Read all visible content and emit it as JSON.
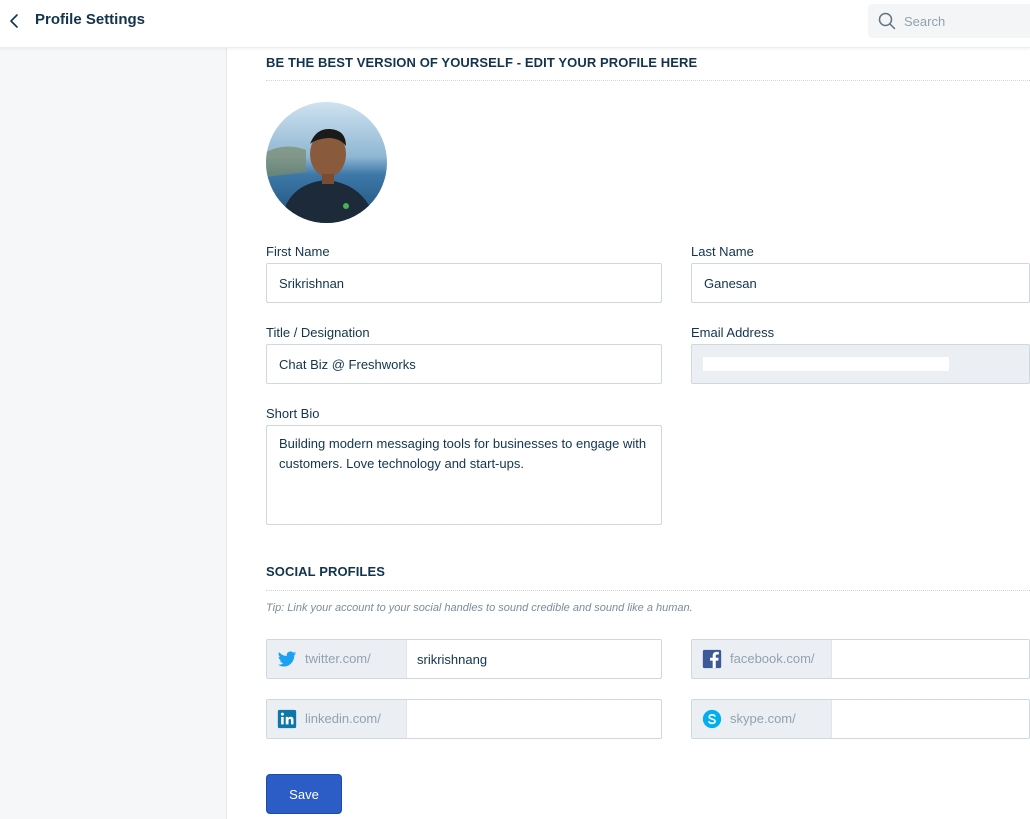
{
  "header": {
    "title": "Profile Settings",
    "search_placeholder": "Search"
  },
  "profile_section": {
    "heading": "BE THE BEST VERSION OF YOURSELF - EDIT YOUR PROFILE HERE"
  },
  "fields": {
    "first_name": {
      "label": "First Name",
      "value": "Srikrishnan"
    },
    "last_name": {
      "label": "Last Name",
      "value": "Ganesan"
    },
    "title": {
      "label": "Title / Designation",
      "value": "Chat Biz @ Freshworks"
    },
    "email": {
      "label": "Email Address",
      "value": ""
    },
    "bio": {
      "label": "Short Bio",
      "value": "Building modern messaging tools for businesses to engage with customers. Love technology and start-ups."
    }
  },
  "social_section": {
    "heading": "SOCIAL PROFILES",
    "tip": "Tip: Link your account to your social handles to sound credible and sound like a human.",
    "twitter": {
      "prefix": "twitter.com/",
      "value": "srikrishnang",
      "icon": "twitter-icon",
      "color": "#1da1f2"
    },
    "facebook": {
      "prefix": "facebook.com/",
      "value": "",
      "icon": "facebook-icon",
      "color": "#3b5998"
    },
    "linkedin": {
      "prefix": "linkedin.com/",
      "value": "",
      "icon": "linkedin-icon",
      "color": "#0e76a8"
    },
    "skype": {
      "prefix": "skype.com/",
      "value": "",
      "icon": "skype-icon",
      "color": "#00aff0"
    }
  },
  "actions": {
    "save_label": "Save"
  },
  "colors": {
    "accent": "#2c5cc5",
    "text": "#12344d",
    "sidebar_bg": "#f5f7f9"
  }
}
